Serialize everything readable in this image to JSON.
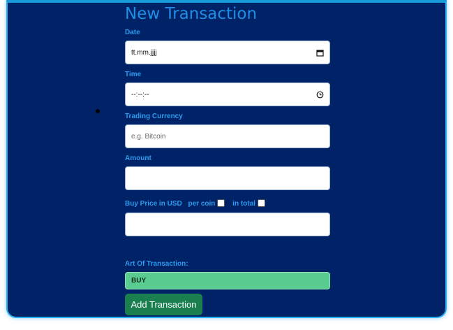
{
  "form": {
    "title": "New Transaction",
    "date": {
      "label": "Date",
      "value": "tt.mm.jjjj",
      "icon": "calendar-icon"
    },
    "time": {
      "label": "Time",
      "value": "--:--:--",
      "icon": "clock-icon"
    },
    "currency": {
      "label": "Trading Currency",
      "placeholder": "e.g. Bitcoin"
    },
    "amount": {
      "label": "Amount",
      "value": ""
    },
    "price": {
      "label": "Buy Price in USD",
      "per_coin_label": "per coin",
      "in_total_label": "in total",
      "value": ""
    },
    "art": {
      "label": "Art Of Transaction:",
      "selected": "BUY"
    },
    "submit_label": "Add Transaction"
  },
  "colors": {
    "panel_bg": "#002266",
    "accent_blue": "#1e8fe6",
    "select_green": "#5acc8f",
    "button_green": "#1a7f4e"
  }
}
